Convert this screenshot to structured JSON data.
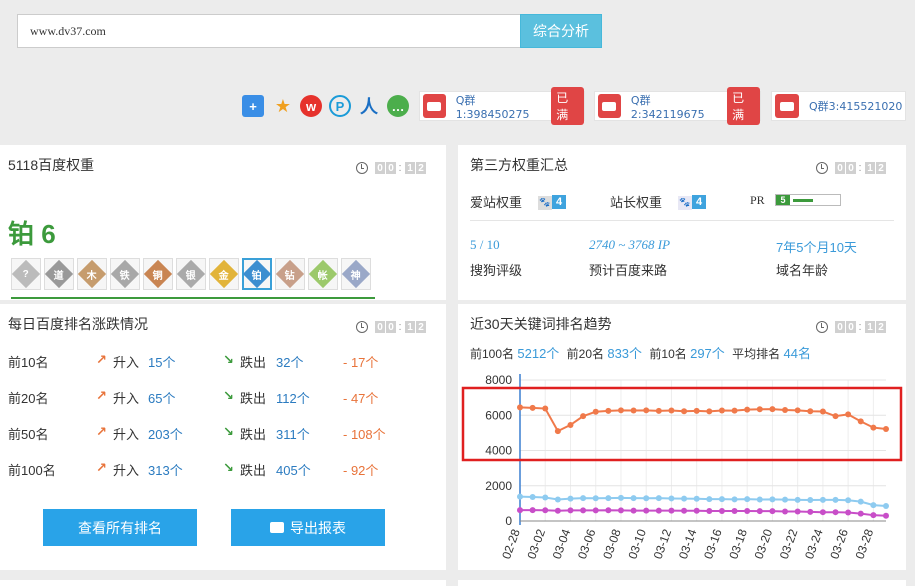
{
  "search": {
    "value": "www.dv37.com",
    "button": "综合分析"
  },
  "qq_groups": [
    {
      "label": "Q群1:398450275",
      "status": "已满"
    },
    {
      "label": "Q群2:342119675",
      "status": "已满"
    },
    {
      "label": "Q群3:415521020"
    }
  ],
  "clock": {
    "d1": "0",
    "d2": "0",
    "d3": "1",
    "d4": "2"
  },
  "weight5118": {
    "title": "5118百度权重",
    "level": "铂 6",
    "medals": [
      "?",
      "道",
      "木",
      "铁",
      "铜",
      "银",
      "金",
      "铂",
      "钻",
      "帐",
      "神"
    ]
  },
  "third_party": {
    "title": "第三方权重汇总",
    "aizhan_label": "爱站权重",
    "aizhan_value": "4",
    "zhanzhang_label": "站长权重",
    "zhanzhang_value": "4",
    "pr_label": "PR",
    "pr_value": "5",
    "sogou_value": "5 / 10",
    "sogou_label": "搜狗评级",
    "traffic_value": "2740 ~ 3768 IP",
    "traffic_label": "预计百度来路",
    "age_value": "7年5个月10天",
    "age_label": "域名年龄"
  },
  "daily": {
    "title": "每日百度排名涨跌情况",
    "rows": [
      {
        "label": "前10名",
        "up": "升入",
        "up_value": "15个",
        "down": "跌出",
        "down_value": "32个",
        "net": "- 17个"
      },
      {
        "label": "前20名",
        "up": "升入",
        "up_value": "65个",
        "down": "跌出",
        "down_value": "112个",
        "net": "- 47个"
      },
      {
        "label": "前50名",
        "up": "升入",
        "up_value": "203个",
        "down": "跌出",
        "down_value": "311个",
        "net": "- 108个"
      },
      {
        "label": "前100名",
        "up": "升入",
        "up_value": "313个",
        "down": "跌出",
        "down_value": "405个",
        "net": "- 92个"
      }
    ],
    "btn_all": "查看所有排名",
    "btn_export": "导出报表"
  },
  "trend": {
    "title": "近30天关键词排名趋势",
    "s_top100_label": "前100名",
    "s_top100": "5212个",
    "s_top20_label": "前20名",
    "s_top20": "833个",
    "s_top10_label": "前10名",
    "s_top10": "297个",
    "s_avg_label": "平均排名",
    "s_avg": "44名"
  },
  "chart_data": {
    "type": "line",
    "categories": [
      "02-28",
      "03-01",
      "03-02",
      "03-03",
      "03-04",
      "03-05",
      "03-06",
      "03-07",
      "03-08",
      "03-09",
      "03-10",
      "03-11",
      "03-12",
      "03-13",
      "03-14",
      "03-15",
      "03-16",
      "03-17",
      "03-18",
      "03-19",
      "03-20",
      "03-21",
      "03-22",
      "03-23",
      "03-24",
      "03-25",
      "03-26",
      "03-27",
      "03-28",
      "03-29"
    ],
    "tick_labels": [
      "02-28",
      "03-02",
      "03-04",
      "03-06",
      "03-08",
      "03-10",
      "03-12",
      "03-14",
      "03-16",
      "03-18",
      "03-20",
      "03-22",
      "03-24",
      "03-26",
      "03-28"
    ],
    "ylim": [
      0,
      8000
    ],
    "yticks": [
      0,
      2000,
      4000,
      6000,
      8000
    ],
    "series": [
      {
        "values": [
          6450,
          6420,
          6380,
          5100,
          5450,
          5950,
          6200,
          6250,
          6280,
          6270,
          6280,
          6250,
          6270,
          6230,
          6250,
          6220,
          6270,
          6260,
          6320,
          6340,
          6350,
          6300,
          6280,
          6230,
          6210,
          5950,
          6050,
          5650,
          5300,
          5220
        ],
        "color": "#f0794a"
      },
      {
        "values": [
          1380,
          1360,
          1330,
          1220,
          1270,
          1300,
          1290,
          1300,
          1310,
          1300,
          1290,
          1300,
          1280,
          1270,
          1260,
          1240,
          1240,
          1230,
          1240,
          1220,
          1230,
          1210,
          1200,
          1190,
          1200,
          1200,
          1180,
          1100,
          900,
          850
        ],
        "color": "#8ecbf0"
      },
      {
        "values": [
          620,
          620,
          610,
          580,
          600,
          600,
          600,
          610,
          600,
          590,
          590,
          590,
          590,
          580,
          580,
          570,
          570,
          570,
          570,
          560,
          560,
          540,
          540,
          520,
          500,
          500,
          480,
          420,
          330,
          300
        ],
        "color": "#c84ec8"
      }
    ]
  }
}
